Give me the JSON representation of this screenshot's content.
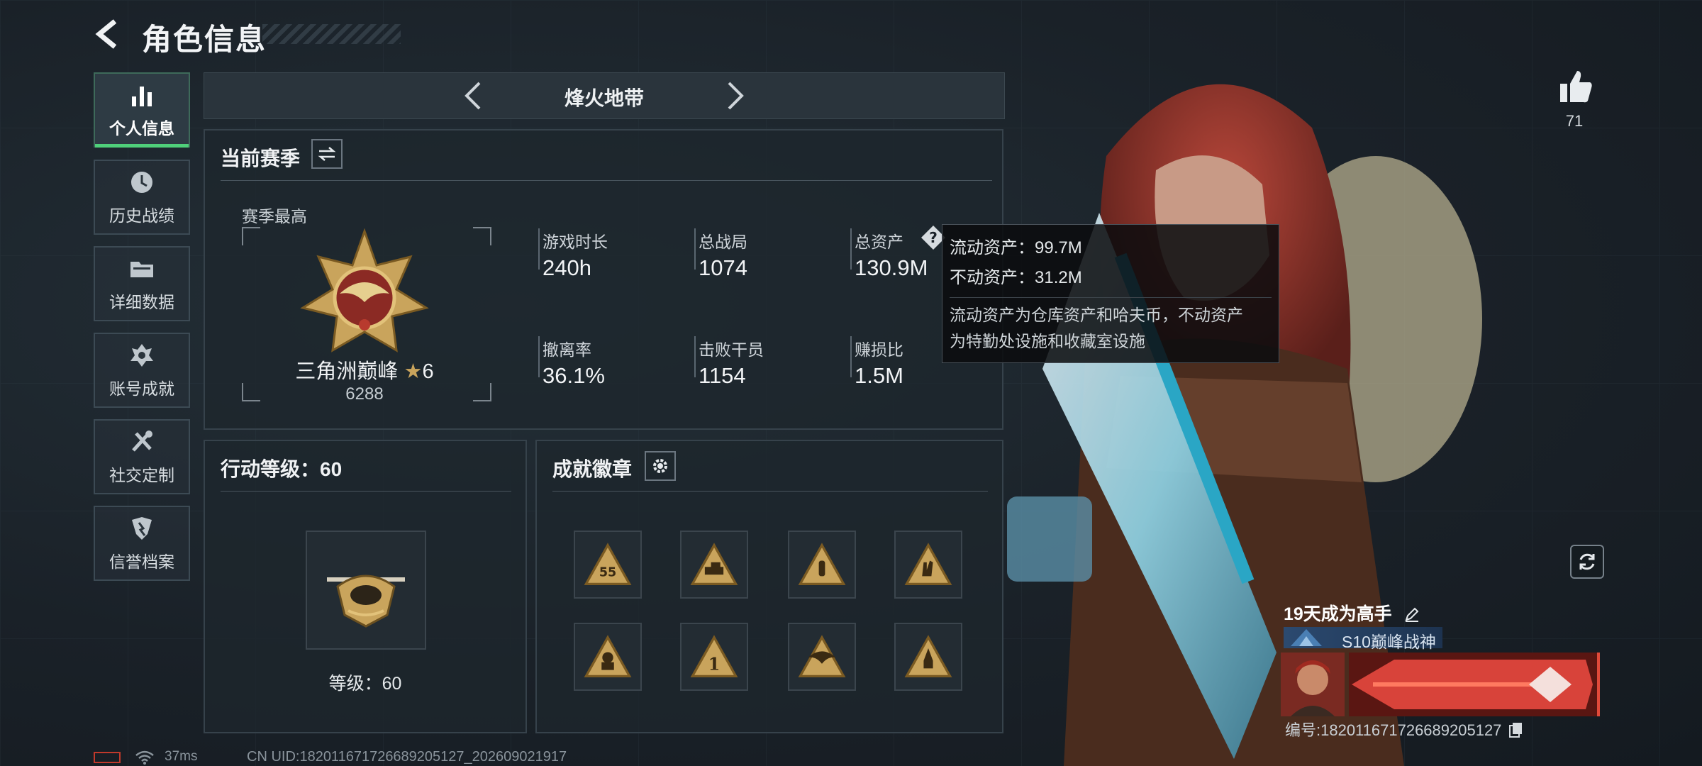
{
  "header": {
    "title": "角色信息"
  },
  "sidebar": {
    "items": [
      {
        "label": "个人信息",
        "icon": "bar-chart-icon",
        "active": true
      },
      {
        "label": "历史战绩",
        "icon": "history-icon"
      },
      {
        "label": "详细数据",
        "icon": "folder-icon"
      },
      {
        "label": "账号成就",
        "icon": "achievement-icon"
      },
      {
        "label": "社交定制",
        "icon": "tools-icon"
      },
      {
        "label": "信誉档案",
        "icon": "shield-icon"
      }
    ]
  },
  "mode_selector": {
    "name": "烽火地带"
  },
  "season": {
    "title": "当前赛季",
    "best_label": "赛季最高",
    "rank_name": "三角洲巅峰",
    "rank_stars": "6",
    "rank_score": "6288",
    "stats": [
      {
        "label": "游戏时长",
        "value": "240h"
      },
      {
        "label": "总战局",
        "value": "1074"
      },
      {
        "label": "总资产",
        "value": "130.9M",
        "has_help": true
      },
      {
        "label": "撤离率",
        "value": "36.1%"
      },
      {
        "label": "击败干员",
        "value": "1154"
      },
      {
        "label": "赚损比",
        "value": "1.5M"
      }
    ]
  },
  "tooltip": {
    "liquid": "流动资产：99.7M",
    "fixed": "不动资产：31.2M",
    "desc_line1": "流动资产为仓库资产和哈夫币，不动资产",
    "desc_line2": "为特勤处设施和收藏室设施"
  },
  "level": {
    "title": "行动等级：60",
    "label": "等级：60"
  },
  "badges": {
    "title": "成就徽章",
    "items": [
      "badge-55",
      "badge-tank",
      "badge-bullet",
      "badge-hand",
      "badge-hazmat",
      "badge-number-1",
      "badge-eagle-s10",
      "badge-rocket"
    ]
  },
  "likes": {
    "count": "71"
  },
  "player": {
    "name": "19天成为高手",
    "title": "S10巅峰战神",
    "uid": "编号:182011671726689205127"
  },
  "footer": {
    "ping": "37ms",
    "uid": "CN UID:182011671726689205127_202609021917"
  },
  "colors": {
    "accent_green": "#4fd07a",
    "gold": "#c9a45c",
    "bg": "#1a2128"
  }
}
